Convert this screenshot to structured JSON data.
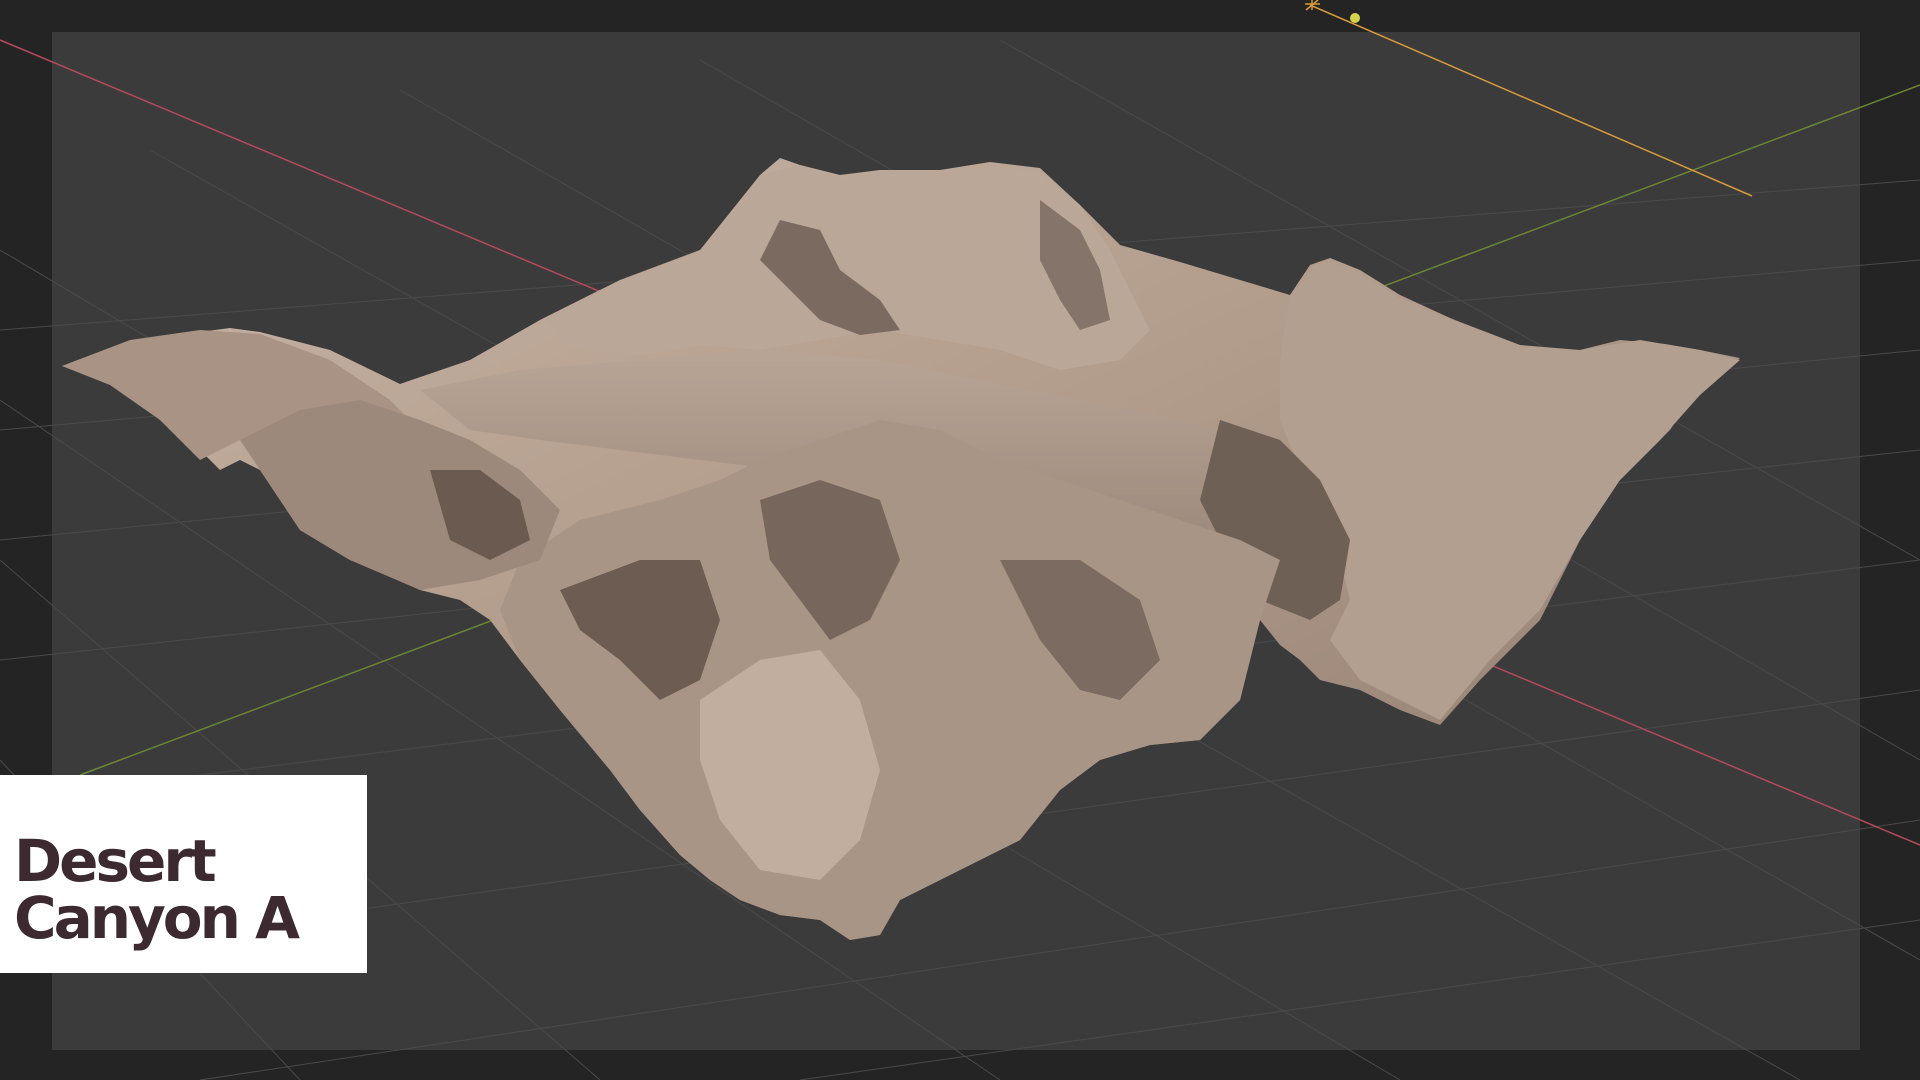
{
  "app": {
    "window_title": "",
    "viewport_mode": "camera-view"
  },
  "title_card": {
    "line1": "Desert",
    "line2": "Canyon A"
  },
  "scene": {
    "object": "terrain-mesh",
    "axes": {
      "x_axis_color": "#b34a5a",
      "y_axis_color": "#6b8a34"
    },
    "light_color": "#d79a3c",
    "light_point_color": "#d8d44a",
    "terrain_colors": {
      "light": "#c9b6a6",
      "mid": "#a48f80",
      "shadow": "#6a5a50"
    }
  },
  "colors": {
    "background": "#242424",
    "frame": "#3b3b3b",
    "grid": "#4a4a4a",
    "title_text": "#3d2a31",
    "title_bg": "#ffffff"
  }
}
